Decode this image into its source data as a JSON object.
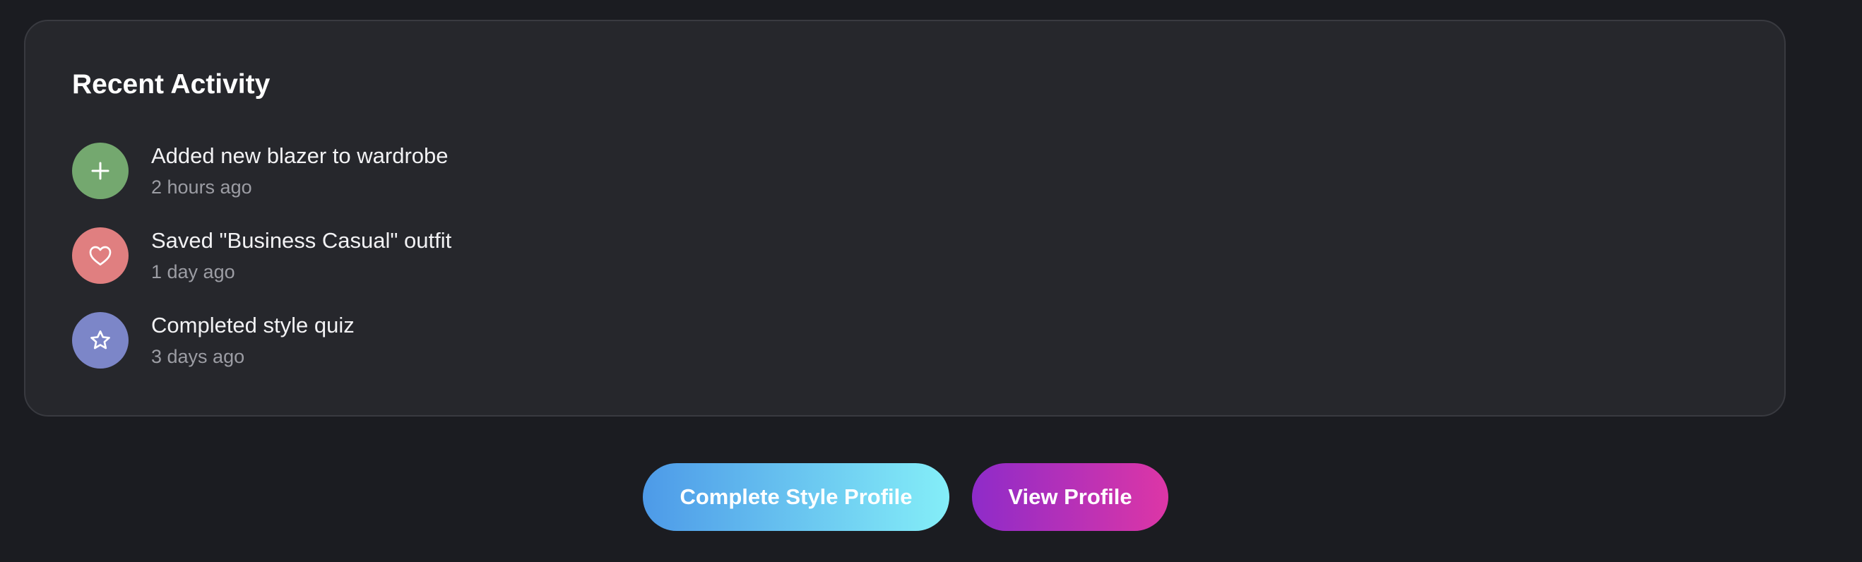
{
  "recent_activity": {
    "title": "Recent Activity",
    "items": [
      {
        "label": "Added new blazer to wardrobe",
        "time": "2 hours ago",
        "icon": "plus-icon",
        "color": "#74a86f"
      },
      {
        "label": "Saved \"Business Casual\" outfit",
        "time": "1 day ago",
        "icon": "heart-icon",
        "color": "#e07f80"
      },
      {
        "label": "Completed style quiz",
        "time": "3 days ago",
        "icon": "star-icon",
        "color": "#7c86c8"
      }
    ]
  },
  "actions": {
    "complete_profile_label": "Complete Style Profile",
    "view_profile_label": "View Profile"
  },
  "colors": {
    "background": "#1b1c21",
    "card": "#26272c",
    "primary_gradient": [
      "#4d9ae8",
      "#84eef8"
    ],
    "secondary_gradient": [
      "#8e2bc9",
      "#dd36a6"
    ]
  }
}
